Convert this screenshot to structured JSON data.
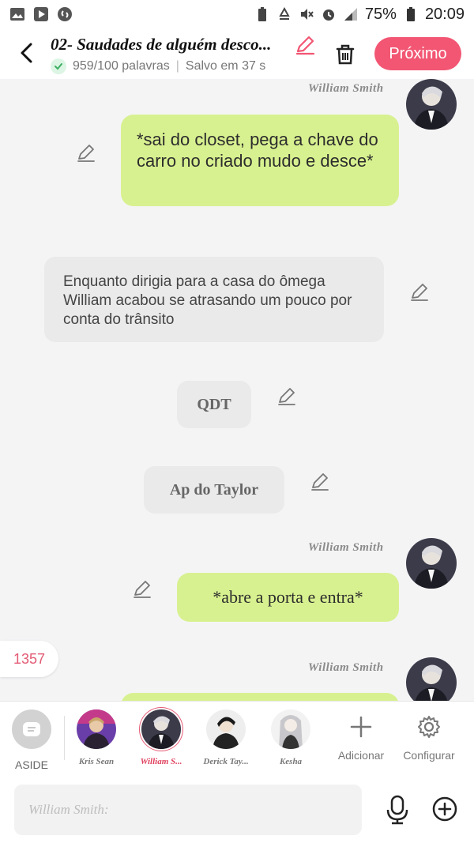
{
  "status_bar": {
    "battery_percent": "75%",
    "time": "20:09",
    "icons": [
      "gallery-icon",
      "play-store-icon",
      "shazam-icon",
      "battery-saver-icon",
      "recycle-icon",
      "mute-icon",
      "alarm-icon",
      "signal-icon",
      "battery-icon"
    ]
  },
  "header": {
    "title": "02- Saudades de alguém desco...",
    "word_count": "959/100 palavras",
    "separator": "|",
    "saved_status": "Salvo em 37 s",
    "next_button": "Próximo"
  },
  "messages": [
    {
      "type": "character",
      "sender": "William Smith",
      "text": "*sai do closet, pega a chave do carro no criado mudo e desce*"
    },
    {
      "type": "narration",
      "text": "Enquanto dirigia para a casa do ômega William acabou se atrasando um pouco por conta do trânsito"
    },
    {
      "type": "scene",
      "text": "QDT"
    },
    {
      "type": "scene",
      "text": "Ap do Taylor"
    },
    {
      "type": "character",
      "sender": "William Smith",
      "text": "*abre a porta e entra*"
    },
    {
      "type": "character",
      "sender": "William Smith",
      "text": ""
    }
  ],
  "count_badge": "1357",
  "character_bar": {
    "aside_label": "ASIDE",
    "characters": [
      {
        "name": "Kris Sean",
        "active": false,
        "color": "#7a4fb0"
      },
      {
        "name": "William S...",
        "active": true,
        "color": "#3b3b4a"
      },
      {
        "name": "Derick Tay...",
        "active": false,
        "color": "#2c2c2c"
      },
      {
        "name": "Kesha",
        "active": false,
        "color": "#bdbdbd"
      }
    ],
    "add_label": "Adicionar",
    "settings_label": "Configurar"
  },
  "input": {
    "placeholder": "William Smith:"
  },
  "colors": {
    "accent": "#f25673",
    "bubble_green": "#d8f190",
    "bubble_grey": "#eaeaea"
  }
}
